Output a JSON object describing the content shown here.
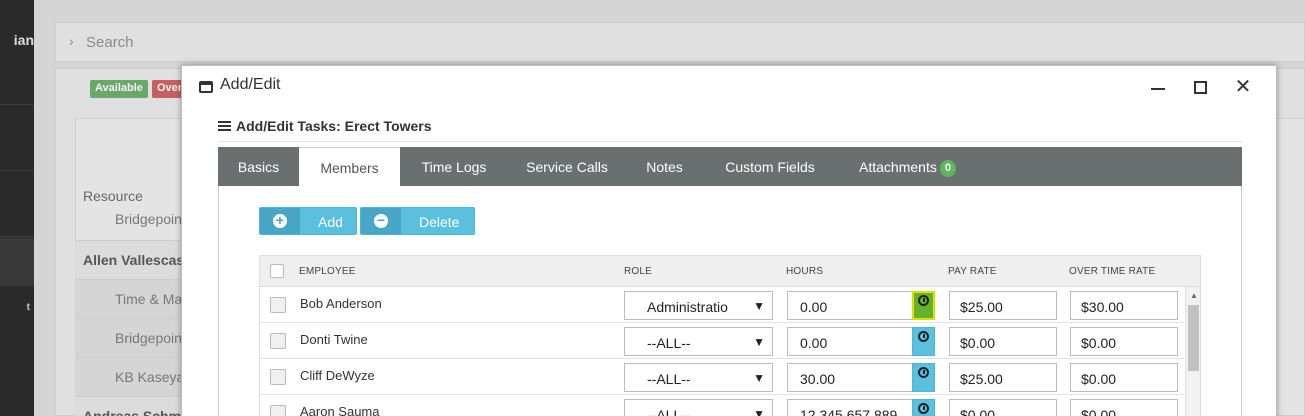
{
  "background": {
    "nav_title": "ian",
    "nav_small": "t",
    "search_placeholder": "Search",
    "badges": {
      "available": "Available",
      "over": "Over"
    },
    "resource_header": "Resource",
    "rows": [
      "Bridgepoint",
      "Allen Vallescas",
      "Time & Ma",
      "Bridgepoint",
      "KB Kaseya",
      "Andreas Schm"
    ]
  },
  "modal": {
    "window_title": "Add/Edit",
    "subtitle": "Add/Edit Tasks: Erect Towers",
    "tabs": [
      {
        "label": "Basics"
      },
      {
        "label": "Members"
      },
      {
        "label": "Time Logs"
      },
      {
        "label": "Service Calls"
      },
      {
        "label": "Notes"
      },
      {
        "label": "Custom Fields"
      },
      {
        "label": "Attachments",
        "count": "0"
      }
    ],
    "active_tab": "Members",
    "buttons": {
      "add": "Add",
      "delete": "Delete"
    },
    "columns": {
      "employee": "EMPLOYEE",
      "role": "ROLE",
      "hours": "HOURS",
      "pay_rate": "PAY RATE",
      "overtime_rate": "OVER TIME RATE"
    },
    "members": [
      {
        "name": "Bob Anderson",
        "role": "Administratio",
        "hours": "0.00",
        "pay_rate": "$25.00",
        "overtime_rate": "$30.00"
      },
      {
        "name": "Donti Twine",
        "role": "--ALL--",
        "hours": "0.00",
        "pay_rate": "$0.00",
        "overtime_rate": "$0.00"
      },
      {
        "name": "Cliff DeWyze",
        "role": "--ALL--",
        "hours": "30.00",
        "pay_rate": "$25.00",
        "overtime_rate": "$0.00"
      },
      {
        "name": "Aaron Sauma",
        "role": "--ALL--",
        "hours": "12,345,657,889",
        "pay_rate": "$0.00",
        "overtime_rate": "$0.00"
      }
    ]
  },
  "colors": {
    "tab_bar": "#6a6f70",
    "button_accent": "#5bc0de",
    "highlight_clock": "#62b32a",
    "badge_count": "#5cb85c"
  },
  "icons": [
    "window-icon",
    "minimize-icon",
    "maximize-icon",
    "close-icon",
    "list-icon",
    "plus-icon",
    "minus-icon",
    "clock-icon",
    "chevron-right-icon",
    "dropdown-arrow-icon"
  ]
}
